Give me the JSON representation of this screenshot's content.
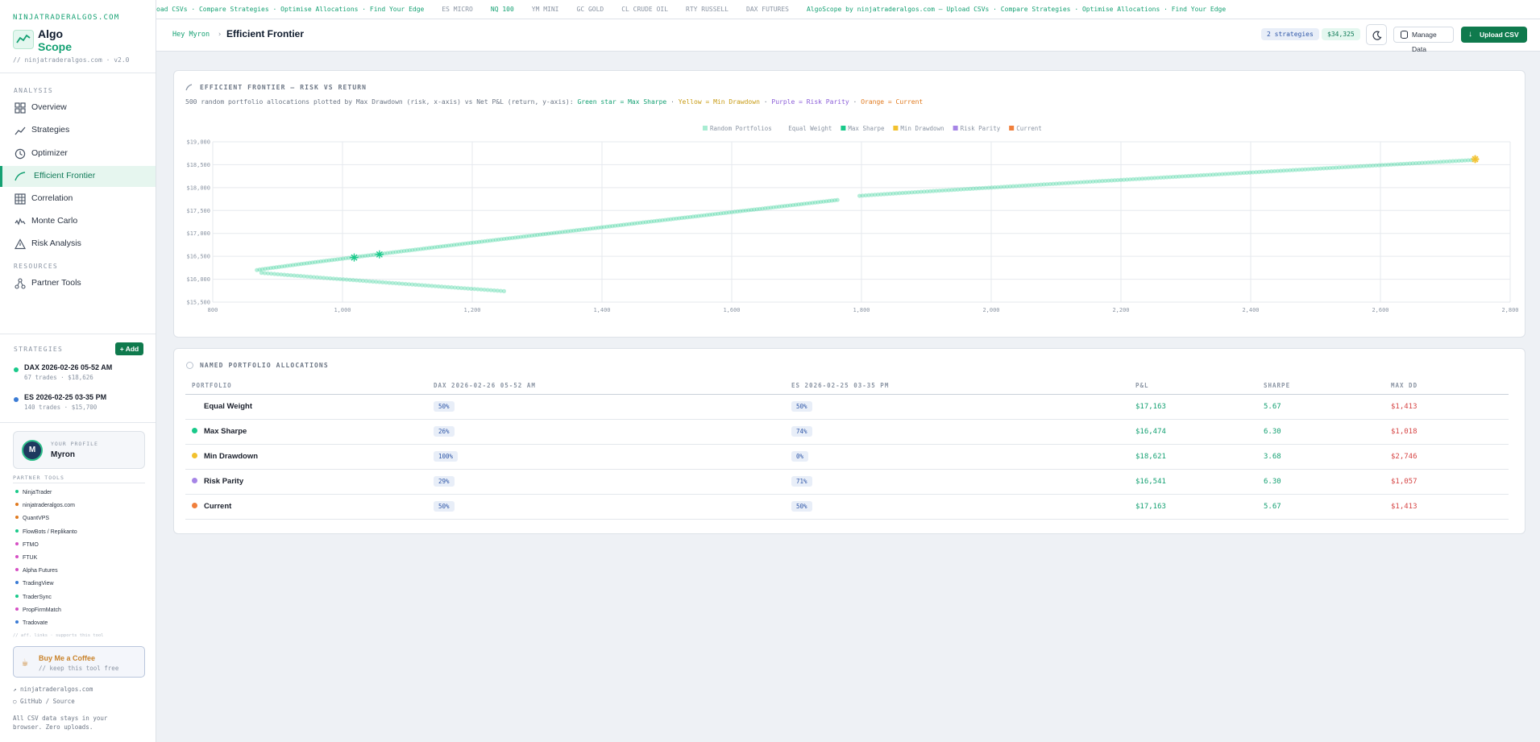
{
  "app": {
    "domain_label": "NINJATRADERALGOS.COM",
    "logo_line1": "Algo",
    "logo_line2": "Scope",
    "version_line": "// ninjatraderalgos.com · v2.0"
  },
  "sidebar": {
    "analysis_label": "ANALYSIS",
    "nav": [
      {
        "label": "Overview",
        "icon": "grid-icon"
      },
      {
        "label": "Strategies",
        "icon": "trend-line-icon"
      },
      {
        "label": "Optimizer",
        "icon": "clock-icon"
      },
      {
        "label": "Efficient Frontier",
        "icon": "frontier-curve-icon",
        "active": true
      },
      {
        "label": "Correlation",
        "icon": "table-grid-icon"
      },
      {
        "label": "Monte Carlo",
        "icon": "wave-icon"
      },
      {
        "label": "Risk Analysis",
        "icon": "warning-triangle-icon"
      }
    ],
    "resources_label": "RESOURCES",
    "partner_tools_nav": "Partner Tools",
    "strategies_label": "STRATEGIES",
    "add_label": "+ Add",
    "strategies": [
      {
        "name": "DAX 2026-02-26 05-52 AM",
        "meta": "67 trades · $18,626",
        "color": "#19c98a"
      },
      {
        "name": "ES 2026-02-25 03-35 PM",
        "meta": "140 trades · $15,700",
        "color": "#3a7bd5"
      }
    ],
    "profile": {
      "initial": "M",
      "label": "YOUR PROFILE",
      "name": "Myron"
    },
    "partner_label": "PARTNER TOOLS",
    "partners": [
      {
        "name": "NinjaTrader",
        "color": "#19c98a"
      },
      {
        "name": "ninjatraderalgos.com",
        "color": "#e07a1f"
      },
      {
        "name": "QuantVPS",
        "color": "#e07a1f"
      },
      {
        "name": "FlowBots / Replikanto",
        "color": "#19c98a"
      },
      {
        "name": "FTMO",
        "color": "#d64fc4"
      },
      {
        "name": "FTUK",
        "color": "#d64fc4"
      },
      {
        "name": "Alpha Futures",
        "color": "#d64fc4"
      },
      {
        "name": "TradingView",
        "color": "#3a7bd5"
      },
      {
        "name": "TraderSync",
        "color": "#19c98a"
      },
      {
        "name": "PropFirmMatch",
        "color": "#d64fc4"
      },
      {
        "name": "Tradovate",
        "color": "#3a7bd5"
      }
    ],
    "affiliate_note": "// aff. links · supports this tool",
    "coffee": {
      "title": "Buy Me a Coffee",
      "sub": "// keep this tool free"
    },
    "footer_link1": "↗ ninjatraderalgos.com",
    "footer_link2": "○ GitHub / Source",
    "footer_note1": "All CSV data stays in your",
    "footer_note2": "browser. Zero uploads."
  },
  "ticker": [
    {
      "text": "oad CSVs · Compare Strategies · Optimise Allocations · Find Your Edge",
      "tone": "g"
    },
    {
      "text": "ES MICRO",
      "tone": "m"
    },
    {
      "text": "NQ 100",
      "tone": "g"
    },
    {
      "text": "YM MINI",
      "tone": "m"
    },
    {
      "text": "GC GOLD",
      "tone": "m"
    },
    {
      "text": "CL CRUDE OIL",
      "tone": "m"
    },
    {
      "text": "RTY RUSSELL",
      "tone": "m"
    },
    {
      "text": "DAX FUTURES",
      "tone": "m"
    },
    {
      "text": "AlgoScope by ninjatraderalgos.com — Upload CSVs · Compare Strategies · Optimise Allocations · Find Your Edge",
      "tone": "g"
    }
  ],
  "header": {
    "greeting": "Hey Myron",
    "sep": "›",
    "title": "Efficient Frontier",
    "strategies_pill": "2 strategies",
    "total_pill": "$34,325",
    "manage_label": "Manage Data",
    "upload_label": "Upload CSV"
  },
  "frontier_card": {
    "title": "EFFICIENT FRONTIER — RISK VS RETURN",
    "desc_main": "500 random portfolio allocations plotted by Max Drawdown (risk, x-axis) vs Net P&L (return, y-axis):",
    "desc_green": "Green star = Max Sharpe",
    "desc_yellow": "Yellow = Min Drawdown",
    "desc_purple": "Purple = Risk Parity",
    "desc_orange": "Orange = Current",
    "desc_dot": "·"
  },
  "allocations_card": {
    "title": "NAMED PORTFOLIO ALLOCATIONS",
    "headers": [
      "PORTFOLIO",
      "DAX 2026-02-26 05-52 AM",
      "ES 2026-02-25 03-35 PM",
      "P&L",
      "SHARPE",
      "MAX DD"
    ],
    "rows": [
      {
        "name": "Equal Weight",
        "color": "",
        "dax": "50%",
        "es": "50%",
        "pnl": "$17,163",
        "sharpe": "5.67",
        "maxdd": "$1,413"
      },
      {
        "name": "Max Sharpe",
        "color": "#19c98a",
        "dax": "26%",
        "es": "74%",
        "pnl": "$16,474",
        "sharpe": "6.30",
        "maxdd": "$1,018"
      },
      {
        "name": "Min Drawdown",
        "color": "#f2c12e",
        "dax": "100%",
        "es": "0%",
        "pnl": "$18,621",
        "sharpe": "3.68",
        "maxdd": "$2,746"
      },
      {
        "name": "Risk Parity",
        "color": "#a685e6",
        "dax": "29%",
        "es": "71%",
        "pnl": "$16,541",
        "sharpe": "6.30",
        "maxdd": "$1,057"
      },
      {
        "name": "Current",
        "color": "#f07f3c",
        "dax": "50%",
        "es": "50%",
        "pnl": "$17,163",
        "sharpe": "5.67",
        "maxdd": "$1,413"
      }
    ]
  },
  "chart_data": {
    "type": "scatter",
    "title": "",
    "xlabel": "",
    "ylabel": "",
    "xlim": [
      800,
      2800
    ],
    "ylim": [
      15500,
      19000
    ],
    "x_ticks": [
      800,
      1000,
      1200,
      1400,
      1600,
      1800,
      2000,
      2200,
      2400,
      2600,
      2800
    ],
    "x_tick_labels": [
      "800",
      "1,000",
      "1,200",
      "1,400",
      "1,600",
      "1,800",
      "2,000",
      "2,200",
      "2,400",
      "2,600",
      "2,800"
    ],
    "y_ticks": [
      15500,
      16000,
      16500,
      17000,
      17500,
      18000,
      18500,
      19000
    ],
    "y_tick_labels": [
      "$15,500",
      "$16,000",
      "$16,500",
      "$17,000",
      "$17,500",
      "$18,000",
      "$18,500",
      "$19,000"
    ],
    "grid": true,
    "legend_position": "top-center",
    "legend": [
      {
        "name": "Random Portfolios",
        "color": "#a8ecd2"
      },
      {
        "name": "Equal Weight",
        "color": "#ffffff"
      },
      {
        "name": "Max Sharpe",
        "color": "#19c98a"
      },
      {
        "name": "Min Drawdown",
        "color": "#f2c12e"
      },
      {
        "name": "Risk Parity",
        "color": "#a685e6"
      },
      {
        "name": "Current",
        "color": "#f07f3c"
      }
    ],
    "series": [
      {
        "name": "Random Portfolios",
        "segments": [
          {
            "x": [
              868,
              1763
            ],
            "y": [
              16200,
              17730
            ],
            "n": 210
          },
          {
            "x": [
              1797,
              2740
            ],
            "y": [
              17820,
              18600
            ],
            "n": 200
          },
          {
            "x": [
              875,
              1249
            ],
            "y": [
              16140,
              15740
            ],
            "n": 75
          }
        ]
      },
      {
        "name": "Max Sharpe",
        "points": [
          {
            "x": 1018,
            "y": 16474
          }
        ]
      },
      {
        "name": "Min Drawdown",
        "points": [
          {
            "x": 2746,
            "y": 18621
          }
        ]
      },
      {
        "name": "Risk Parity",
        "points": [
          {
            "x": 1057,
            "y": 16541
          }
        ]
      }
    ]
  }
}
